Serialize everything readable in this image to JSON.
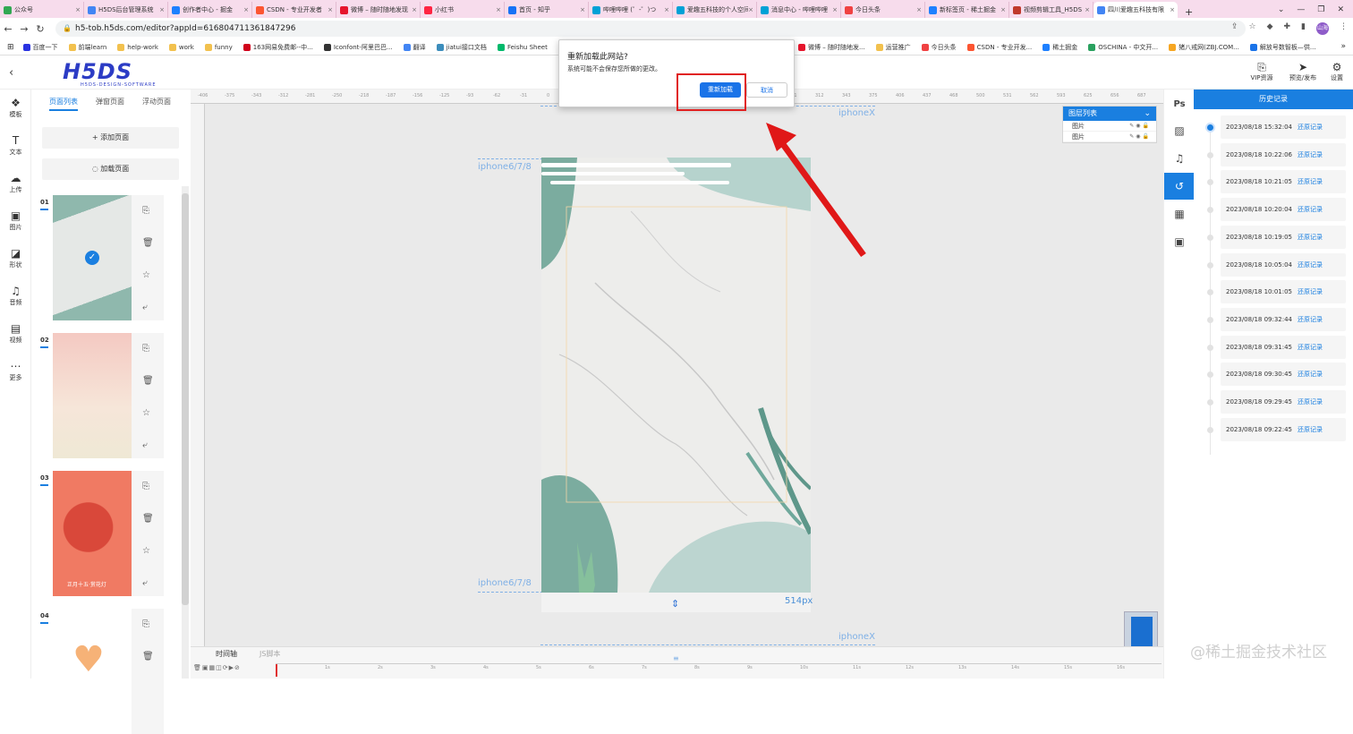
{
  "browser": {
    "tabs": [
      {
        "label": "公众号",
        "color": "#33a853"
      },
      {
        "label": "H5DS后台管理系统",
        "color": "#4285f4"
      },
      {
        "label": "创作者中心 - 掘金",
        "color": "#1e80ff"
      },
      {
        "label": "CSDN - 专业开发者",
        "color": "#fc5531"
      },
      {
        "label": "微博 – 随时随地发现",
        "color": "#e6162d"
      },
      {
        "label": "小红书",
        "color": "#ff2442"
      },
      {
        "label": "首页 - 知乎",
        "color": "#1772f6"
      },
      {
        "label": "哔哩哔哩 (゜-゜)つ",
        "color": "#00a1d6"
      },
      {
        "label": "爱趣五科技的个人空间",
        "color": "#00a1d6"
      },
      {
        "label": "消息中心 - 哔哩哔哩",
        "color": "#00a1d6"
      },
      {
        "label": "今日头条",
        "color": "#f04142"
      },
      {
        "label": "新标签页 - 稀土掘金",
        "color": "#1e80ff"
      },
      {
        "label": "视频剪辑工具_H5DS",
        "color": "#c0392b"
      },
      {
        "label": "四川爱趣五科技有限",
        "color": "#4285f4",
        "active": true
      }
    ],
    "new_tab": "+",
    "url": "h5-tob.h5ds.com/editor?appId=6168047113618472​96",
    "avatar_text": "山海",
    "bookmarks": [
      {
        "label": "百度一下",
        "color": "#2932e1"
      },
      {
        "label": "前端learn",
        "color": "#f2c14e"
      },
      {
        "label": "help-work",
        "color": "#f2c14e"
      },
      {
        "label": "work",
        "color": "#f2c14e"
      },
      {
        "label": "funny",
        "color": "#f2c14e"
      },
      {
        "label": "163网易免费邮--中...",
        "color": "#d0021b"
      },
      {
        "label": "Iconfont-阿里巴巴...",
        "color": "#333333"
      },
      {
        "label": "翻译",
        "color": "#4285f4"
      },
      {
        "label": "jiatui接口文档",
        "color": "#3c8dbc"
      },
      {
        "label": "Feishu Sheet",
        "color": "#00b96b"
      }
    ],
    "bookmarks_right": [
      {
        "label": "微博 – 随时随地发...",
        "color": "#e6162d"
      },
      {
        "label": "运营推广",
        "color": "#f2c14e"
      },
      {
        "label": "今日头条",
        "color": "#f04142"
      },
      {
        "label": "CSDN - 专业开发...",
        "color": "#fc5531"
      },
      {
        "label": "稀土掘金",
        "color": "#1e80ff"
      },
      {
        "label": "OSCHINA - 中文开...",
        "color": "#2aa15f"
      },
      {
        "label": "猪八戒网(ZBJ.COM...",
        "color": "#f6a623"
      },
      {
        "label": "解放号数智板—供...",
        "color": "#1a73e8"
      }
    ],
    "bookmarks_more": "»"
  },
  "dialog": {
    "title": "重新加载此网站?",
    "message": "系统可能不会保存您所做的更改。",
    "confirm": "重新加载",
    "cancel": "取消"
  },
  "header": {
    "logo": "H5DS",
    "logo_sub": "H5DS-DESIGN-SOFTWARE",
    "back_icon": "chevron-left-icon",
    "buttons": [
      {
        "label": "VIP资源",
        "icon": "vip-icon"
      },
      {
        "label": "预览/发布",
        "icon": "send-icon"
      },
      {
        "label": "设置",
        "icon": "gear-icon"
      }
    ]
  },
  "left_toolbar": [
    {
      "label": "模板",
      "icon": "template-icon"
    },
    {
      "label": "文本",
      "icon": "text-icon"
    },
    {
      "label": "上传",
      "icon": "upload-icon"
    },
    {
      "label": "图片",
      "icon": "image-icon"
    },
    {
      "label": "形状",
      "icon": "shape-icon"
    },
    {
      "label": "音频",
      "icon": "audio-icon"
    },
    {
      "label": "视频",
      "icon": "video-icon"
    },
    {
      "label": "更多",
      "icon": "more-icon"
    }
  ],
  "pages_panel": {
    "tabs": [
      "页面列表",
      "弹窗页面",
      "浮动页面"
    ],
    "active_tab": "页面列表",
    "add_page": "添加页面",
    "load_page": "加载页面",
    "pages": [
      {
        "num": "01",
        "bg": "#dfe6e3",
        "selected": true
      },
      {
        "num": "02",
        "bg": "#f3d6cf"
      },
      {
        "num": "03",
        "bg": "#f07a63",
        "caption": "正月十五·赏花灯"
      },
      {
        "num": "04",
        "bg": "#ffffff"
      }
    ]
  },
  "canvas": {
    "ruler_ticks": [
      "-406",
      "-375",
      "-343",
      "-312",
      "-281",
      "-250",
      "-218",
      "-187",
      "-156",
      "-125",
      "-93",
      "-62",
      "-31",
      "0",
      "31",
      "62",
      "93",
      "125",
      "156",
      "187",
      "218",
      "250",
      "281",
      "312",
      "343",
      "375",
      "406",
      "437",
      "468",
      "500",
      "531",
      "562",
      "593",
      "625",
      "656",
      "687",
      "718"
    ],
    "guide_labels": {
      "iphonex_top": "iphoneX",
      "iphone678_top": "iphone6/7/8",
      "iphone678_bottom": "iphone6/7/8",
      "iphonex_bottom": "iphoneX"
    },
    "page_height_label": "514px"
  },
  "layers_panel": {
    "title": "图层列表",
    "items": [
      "图片",
      "图片"
    ]
  },
  "right_toolbar": [
    {
      "label": "Ps",
      "icon": "ps-icon"
    },
    {
      "icon": "texture-icon"
    },
    {
      "icon": "music-icon"
    },
    {
      "icon": "history-icon",
      "active": true
    },
    {
      "icon": "grid-icon"
    },
    {
      "icon": "picture-icon"
    }
  ],
  "history": {
    "title": "历史记录",
    "restore_label": "还原记录",
    "entries": [
      "2023/08/18 15:32:04",
      "2023/08/18 10:22:06",
      "2023/08/18 10:21:05",
      "2023/08/18 10:20:04",
      "2023/08/18 10:19:05",
      "2023/08/18 10:05:04",
      "2023/08/18 10:01:05",
      "2023/08/18 09:32:44",
      "2023/08/18 09:31:45",
      "2023/08/18 09:30:45",
      "2023/08/18 09:29:45",
      "2023/08/18 09:22:45"
    ]
  },
  "timeline": {
    "tabs": [
      "时间轴",
      "JS脚本"
    ],
    "ticks": [
      "1s",
      "2s",
      "3s",
      "4s",
      "5s",
      "6s",
      "7s",
      "8s",
      "9s",
      "10s",
      "11s",
      "12s",
      "13s",
      "14s",
      "15s",
      "16s"
    ]
  },
  "watermark": "@稀土掘金技术社区"
}
